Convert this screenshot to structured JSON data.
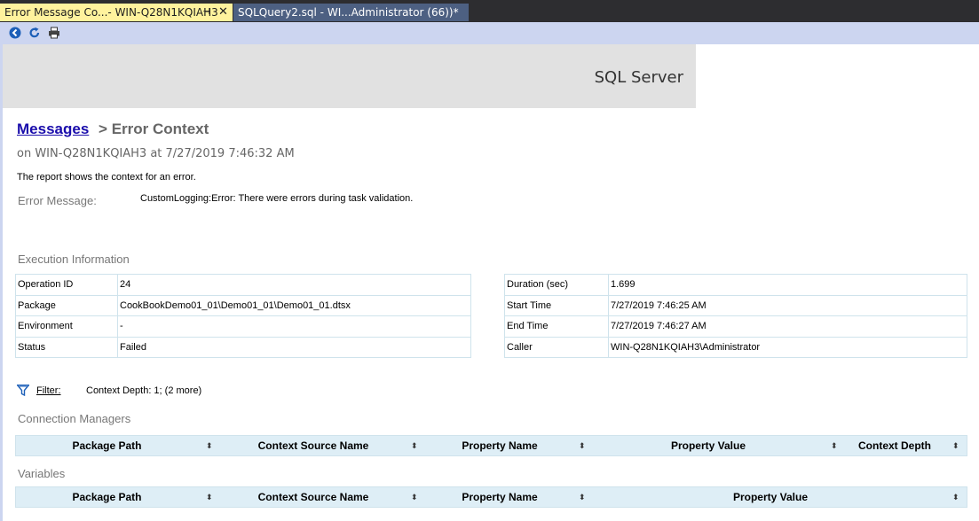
{
  "tabs": {
    "active_label": "Error Message Co...- WIN-Q28N1KQIAH3",
    "pin_glyph": "⊣",
    "close_glyph": "✕",
    "inactive_label": "SQLQuery2.sql - WI...Administrator (66))*"
  },
  "banner": {
    "brand": "SQL Server"
  },
  "breadcrumb": {
    "link": "Messages",
    "separator": ">",
    "current": "Error Context"
  },
  "subtitle": "on WIN-Q28N1KQIAH3 at 7/27/2019 7:46:32 AM",
  "description": "The report shows the context for an error.",
  "error": {
    "label": "Error Message:",
    "value": "CustomLogging:Error: There were errors during task validation."
  },
  "execution": {
    "title": "Execution Information",
    "left": [
      {
        "key": "Operation ID",
        "value": "24"
      },
      {
        "key": "Package",
        "value": "CookBookDemo01_01\\Demo01_01\\Demo01_01.dtsx"
      },
      {
        "key": "Environment",
        "value": "-"
      },
      {
        "key": "Status",
        "value": "Failed"
      }
    ],
    "right": [
      {
        "key": "Duration (sec)",
        "value": "1.699"
      },
      {
        "key": "Start Time",
        "value": "7/27/2019 7:46:25 AM"
      },
      {
        "key": "End Time",
        "value": "7/27/2019 7:46:27 AM"
      },
      {
        "key": "Caller",
        "value": "WIN-Q28N1KQIAH3\\Administrator"
      }
    ]
  },
  "filter": {
    "label": "Filter:",
    "text": "Context Depth: 1;  (2 more)"
  },
  "connection_managers": {
    "title": "Connection Managers",
    "columns": [
      "Package Path",
      "Context Source Name",
      "Property Name",
      "Property Value",
      "Context Depth"
    ]
  },
  "variables": {
    "title": "Variables",
    "columns": [
      "Package Path",
      "Context Source Name",
      "Property Name",
      "Property Value"
    ]
  },
  "sort_glyph": "⬍",
  "colors": {
    "tab_active": "#fff29d",
    "tab_inactive": "#4d6082",
    "toolbar": "#ccd5f0",
    "header_row": "#deeef6",
    "link": "#1a0dab"
  }
}
